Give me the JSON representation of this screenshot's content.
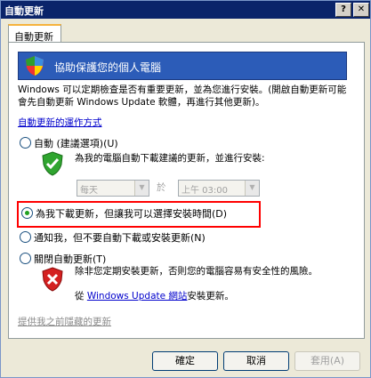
{
  "window": {
    "title": "自動更新",
    "help_glyph": "?",
    "close_glyph": "✕"
  },
  "tabs": [
    {
      "label": "自動更新"
    }
  ],
  "banner": {
    "title": "協助保護您的個人電腦"
  },
  "description": "Windows 可以定期檢查是否有重要更新，並為您進行安裝。(開啟自動更新可能會先自動更新 Windows Update 軟體，再進行其他更新)。",
  "how_link": "自動更新的運作方式",
  "options": {
    "auto": {
      "label": "自動 (建議選項)(U)",
      "note": "為我的電腦自動下載建議的更新，並進行安裝:",
      "day_value": "每天",
      "between": "於",
      "time_value": "上午 03:00"
    },
    "download": {
      "label": "為我下載更新，但讓我可以選擇安裝時間(D)"
    },
    "notify": {
      "label": "通知我，但不要自動下載或安裝更新(N)"
    },
    "off": {
      "label": "關閉自動更新(T)",
      "note1": "除非您定期安裝更新，否則您的電腦容易有安全性的風險。",
      "note2_pre": "從 ",
      "note2_link": "Windows Update 網站",
      "note2_post": "安裝更新。"
    }
  },
  "selected_option": "download",
  "previous_link": "提供我之前隱藏的更新",
  "buttons": {
    "ok": "確定",
    "cancel": "取消",
    "apply": "套用(A)"
  }
}
